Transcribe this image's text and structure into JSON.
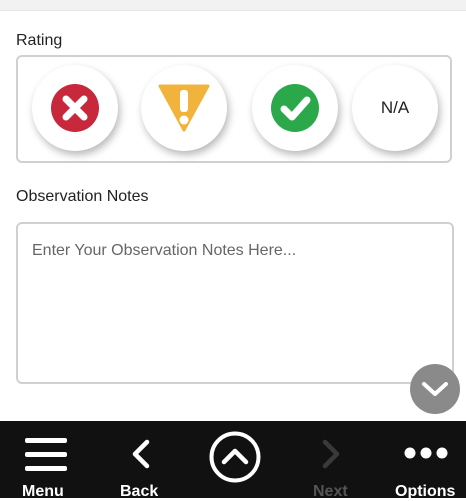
{
  "rating": {
    "label": "Rating",
    "options": [
      {
        "name": "fail",
        "icon": "x-circle-icon",
        "color": "#c8283b"
      },
      {
        "name": "warning",
        "icon": "warning-triangle-icon",
        "color": "#f2b33d"
      },
      {
        "name": "pass",
        "icon": "check-circle-icon",
        "color": "#2aa84a"
      },
      {
        "name": "not-applicable",
        "text": "N/A"
      }
    ]
  },
  "notes": {
    "label": "Observation Notes",
    "value": "",
    "placeholder": "Enter Your Observation Notes Here..."
  },
  "scroll_button": {
    "icon": "chevron-down-icon",
    "color": "#8a8a8a"
  },
  "bottom_bar": {
    "menu": {
      "label": "Menu",
      "icon": "hamburger-icon"
    },
    "back": {
      "label": "Back",
      "icon": "chevron-left-icon"
    },
    "home": {
      "icon": "chevron-up-circle-icon"
    },
    "next": {
      "label": "Next",
      "icon": "chevron-right-icon",
      "enabled": false
    },
    "options": {
      "label": "Options",
      "icon": "more-dots-icon"
    }
  }
}
